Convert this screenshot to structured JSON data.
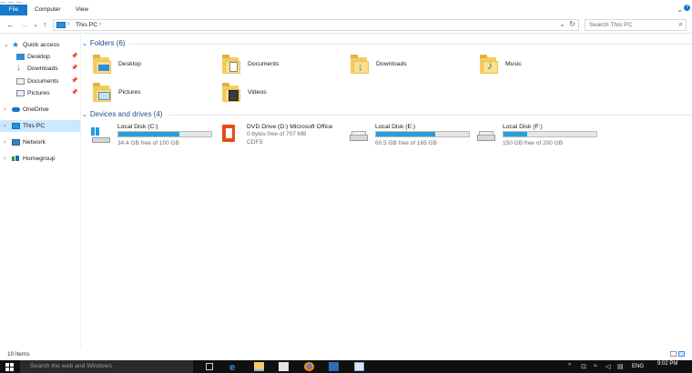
{
  "ribbon": {
    "tabs": [
      {
        "label": "File",
        "active": true
      },
      {
        "label": "Computer",
        "active": false
      },
      {
        "label": "View",
        "active": false
      }
    ],
    "icons": {
      "collapse": "chevron-down-icon",
      "help": "help-icon"
    }
  },
  "navigation": {
    "breadcrumb": [
      {
        "label": "This PC"
      }
    ],
    "search_placeholder": "Search This PC",
    "icons": {
      "back": "back-arrow-icon",
      "forward": "forward-arrow-icon",
      "recent": "recent-locations-icon",
      "up": "up-arrow-icon",
      "refresh": "refresh-icon",
      "search": "search-icon"
    }
  },
  "sidebar": {
    "items": [
      {
        "label": "Quick access",
        "icon": "star-icon",
        "level": 0,
        "expanded": true,
        "selected": false
      },
      {
        "label": "Desktop",
        "icon": "desktop-folder-icon",
        "level": 1,
        "pinned": true
      },
      {
        "label": "Downloads",
        "icon": "downloads-folder-icon",
        "level": 1,
        "pinned": true
      },
      {
        "label": "Documents",
        "icon": "documents-folder-icon",
        "level": 1,
        "pinned": true
      },
      {
        "label": "Pictures",
        "icon": "pictures-folder-icon",
        "level": 1,
        "pinned": true
      },
      {
        "label": "OneDrive",
        "icon": "cloud-icon",
        "level": 0,
        "expanded": false
      },
      {
        "label": "This PC",
        "icon": "computer-icon",
        "level": 0,
        "expanded": false,
        "selected": true
      },
      {
        "label": "Network",
        "icon": "network-icon",
        "level": 0,
        "expanded": false
      },
      {
        "label": "Homegroup",
        "icon": "homegroup-icon",
        "level": 0,
        "expanded": false
      }
    ]
  },
  "content": {
    "folders_header": "Folders (6)",
    "folders": [
      {
        "label": "Desktop",
        "icon": "desktop-folder-icon"
      },
      {
        "label": "Documents",
        "icon": "documents-folder-icon"
      },
      {
        "label": "Downloads",
        "icon": "downloads-folder-icon"
      },
      {
        "label": "Music",
        "icon": "music-folder-icon"
      },
      {
        "label": "Pictures",
        "icon": "pictures-folder-icon"
      },
      {
        "label": "Videos",
        "icon": "videos-folder-icon"
      }
    ],
    "drives_header": "Devices and drives (4)",
    "drives": [
      {
        "name": "Local Disk (C:)",
        "free": "34.4 GB free of 100 GB",
        "used_fraction": 0.656,
        "icon": "windows-drive-icon"
      },
      {
        "name": "DVD Drive (D:) Microsoft Office",
        "free": "0 bytes free of 707 MB",
        "filesystem": "CDFS",
        "icon": "office-disc-icon"
      },
      {
        "name": "Local Disk (E:)",
        "free": "60.5 GB free of 165 GB",
        "used_fraction": 0.633,
        "icon": "hard-drive-icon"
      },
      {
        "name": "Local Disk (F:)",
        "free": "150 GB free of 200 GB",
        "used_fraction": 0.25,
        "icon": "hard-drive-icon"
      }
    ]
  },
  "statusbar": {
    "item_count": "10 items"
  },
  "taskbar": {
    "search_placeholder": "Search the web and Windows",
    "apps": [
      "task-view-icon",
      "edge-icon",
      "file-explorer-icon",
      "store-icon",
      "chrome-icon",
      "app-icon",
      "app-icon"
    ],
    "tray": {
      "language": "ENG",
      "time": "9:02 PM",
      "icons": [
        "chevron-up-icon",
        "network-icon",
        "wifi-icon",
        "volume-icon",
        "action-center-icon"
      ]
    }
  },
  "colors": {
    "accent": "#1979ca",
    "selection": "#cce8ff",
    "progress": "#26a0da",
    "header": "#1e4e8c"
  }
}
